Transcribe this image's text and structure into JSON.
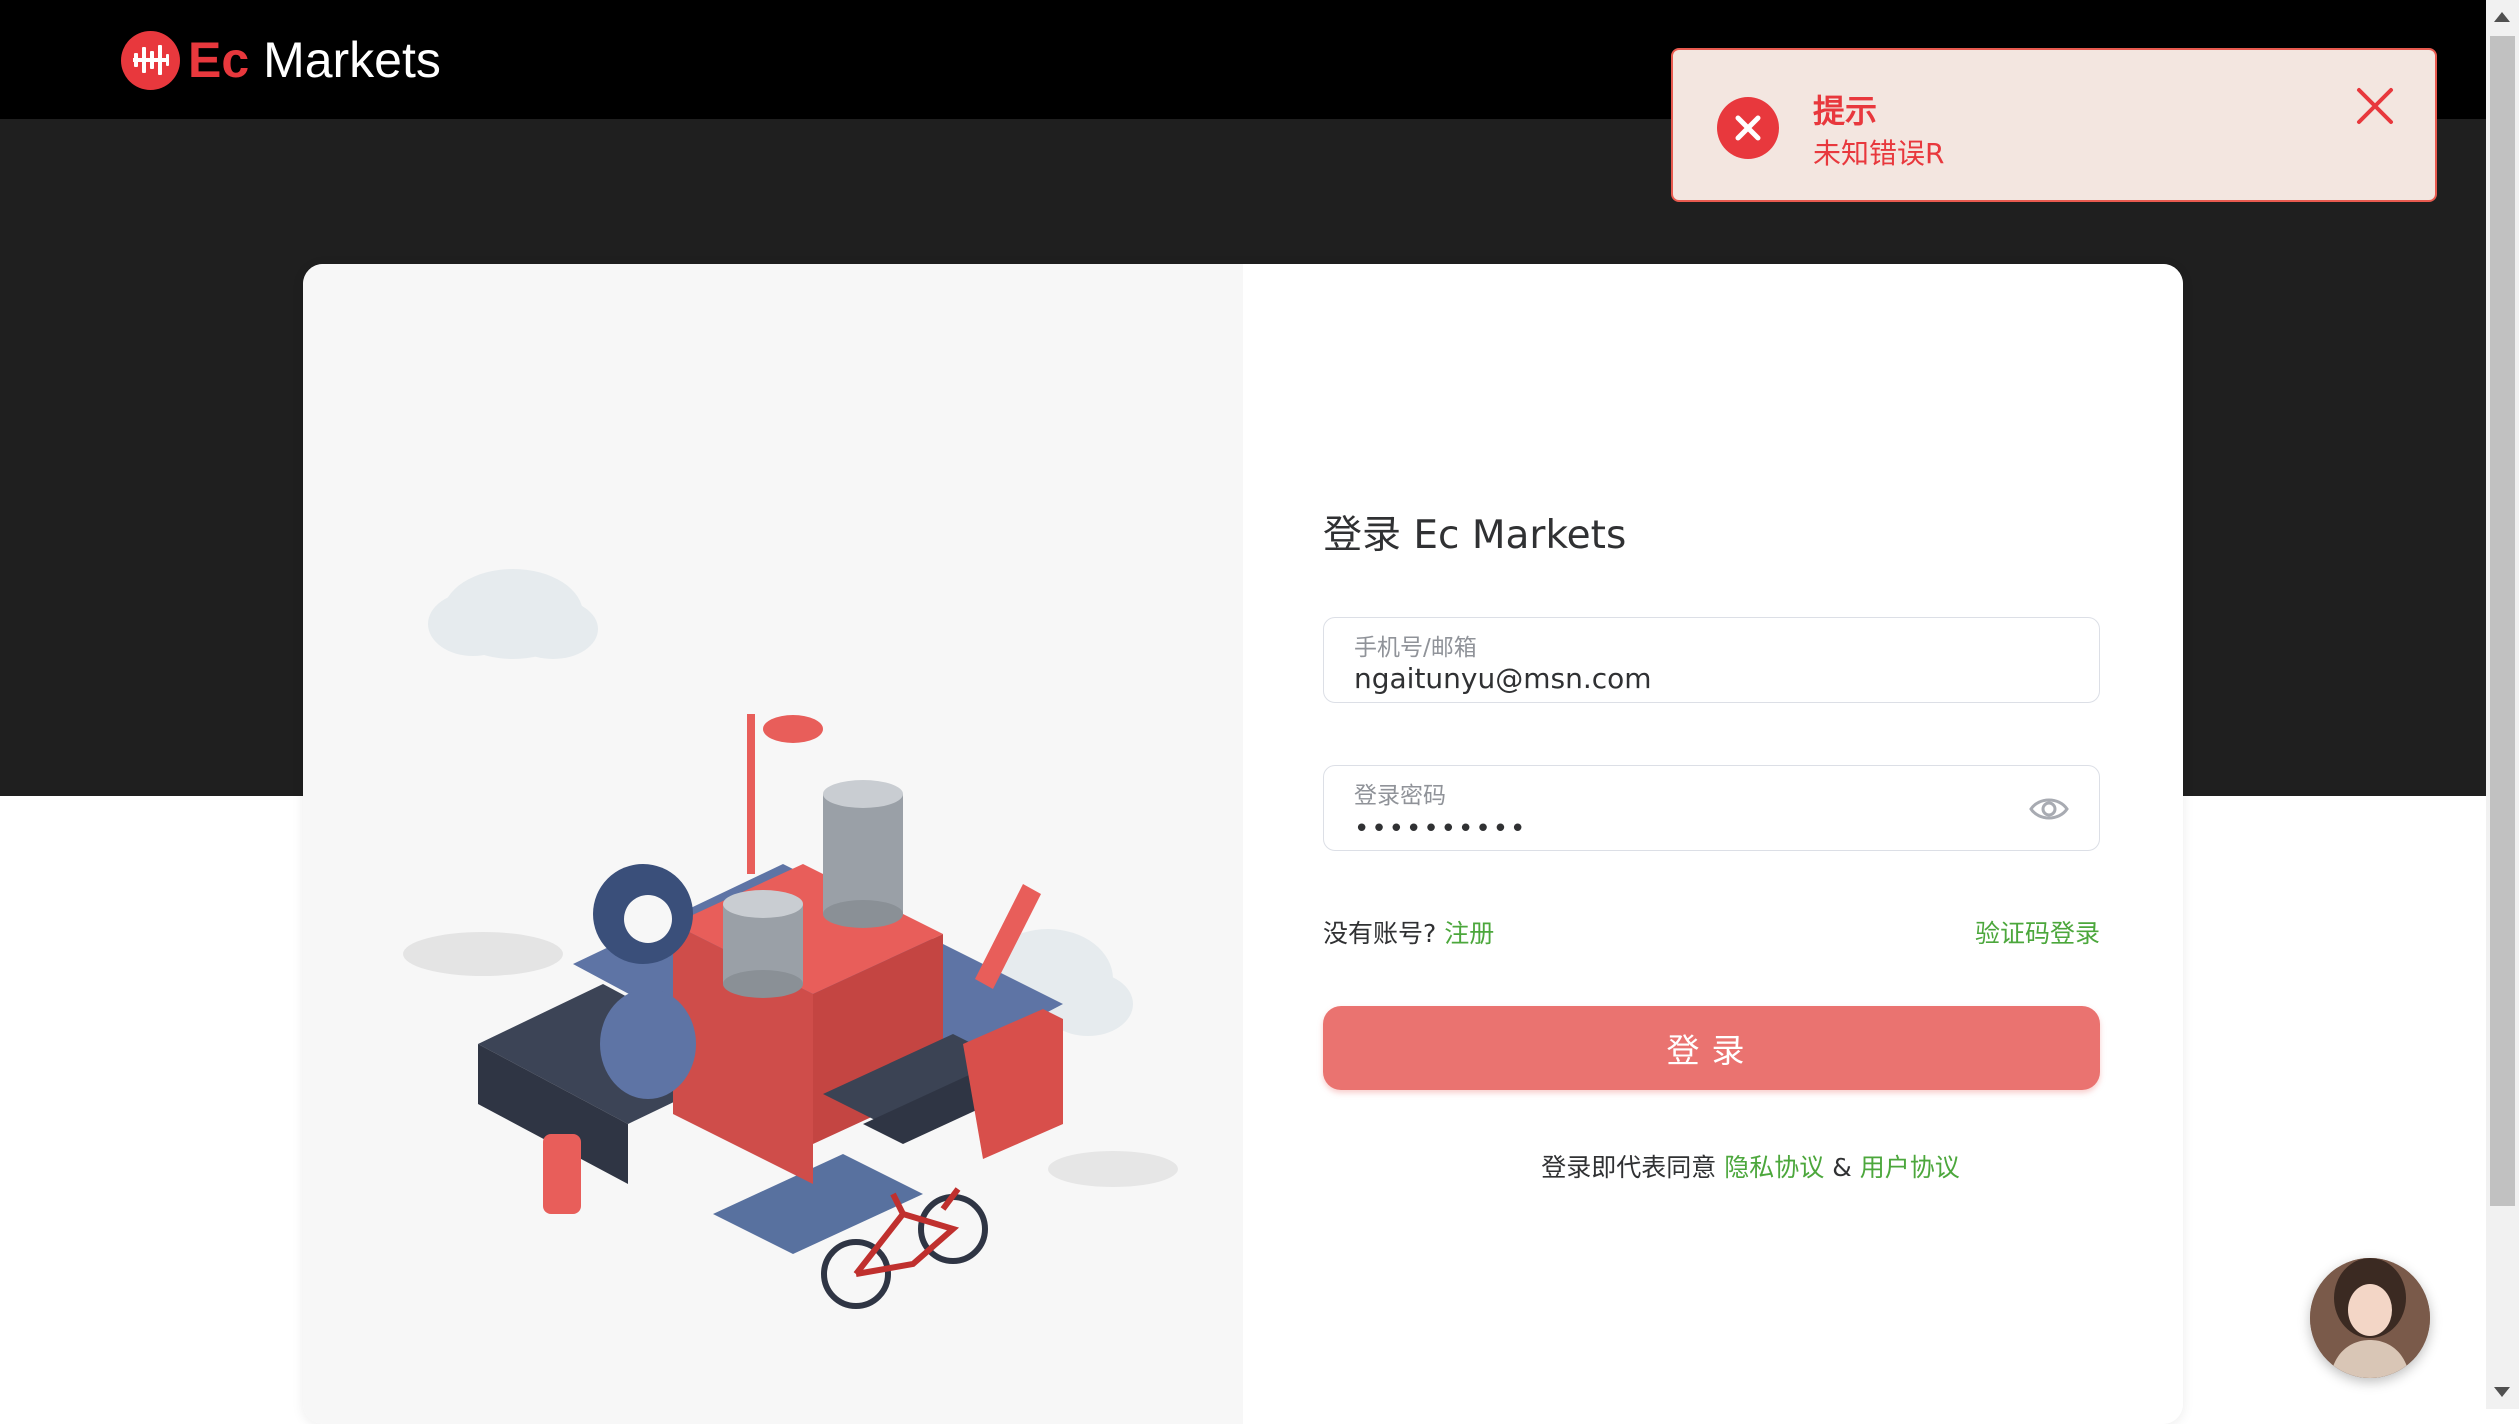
{
  "header": {
    "brand_ec": "Ec",
    "brand_markets": " Markets"
  },
  "login": {
    "title": "登录 Ec Markets",
    "account_label": "手机号/邮箱",
    "account_value": "ngaitunyu@msn.com",
    "password_label": "登录密码",
    "password_mask": "••••••••••",
    "no_account": "没有账号?",
    "register_link": "注册",
    "sms_login_link": "验证码登录",
    "submit_label": "登录",
    "agree_prefix": "登录即代表同意",
    "privacy_link": "隐私协议",
    "amp": "&",
    "user_agreement_link": "用户协议"
  },
  "toast": {
    "title": "提示",
    "message": "未知错误R"
  },
  "icons": {
    "logo": "ec-markets-logo-icon",
    "eye": "eye-icon",
    "error": "error-circle-icon",
    "close": "close-icon",
    "chat": "customer-service-avatar"
  },
  "colors": {
    "brand_red": "#e8383d",
    "button": "#ea7370",
    "link_green": "#4ca73c",
    "toast_bg": "#f3e6e0"
  }
}
